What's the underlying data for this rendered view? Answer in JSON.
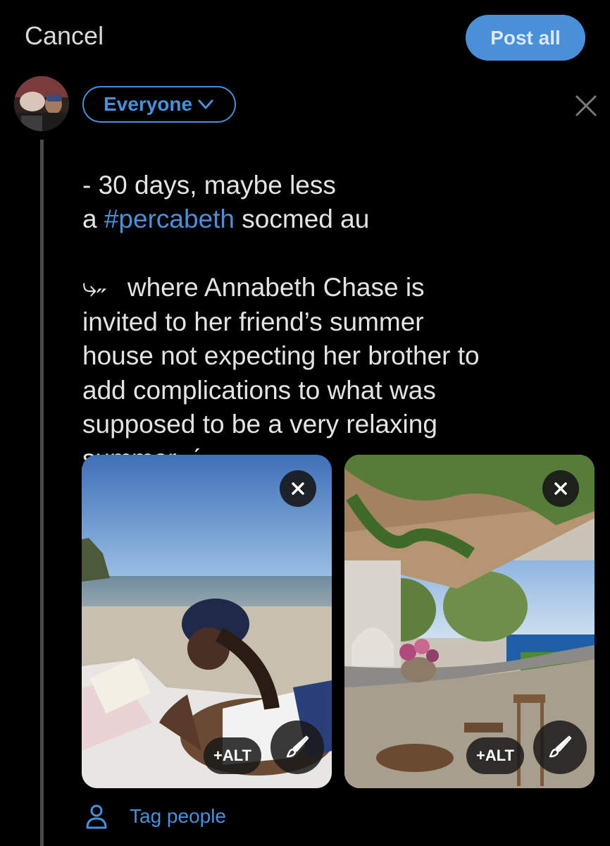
{
  "header": {
    "cancel_label": "Cancel",
    "post_label": "Post all"
  },
  "composer": {
    "audience_label": "Everyone",
    "text_line1": "- 30 days, maybe less",
    "text_line2_prefix": "a ",
    "hashtag": "#percabeth",
    "text_line2_suffix": " socmed au",
    "text_body": "   where Annabeth Chase is\ninvited to her friend’s summer\nhouse not expecting her brother to\nadd complications to what was\nsupposed to be a very relaxing\nsummer ˎˊ-",
    "arrow_glyph": "⤷˶"
  },
  "media": [
    {
      "alt_label": "+ALT",
      "description_icon": "beach-reading-photo"
    },
    {
      "alt_label": "+ALT",
      "description_icon": "outdoor-bar-photo"
    }
  ],
  "footer": {
    "tag_label": "Tag people"
  },
  "colors": {
    "accent": "#4a90d9",
    "background": "#000000",
    "text": "#e3e3e3"
  }
}
